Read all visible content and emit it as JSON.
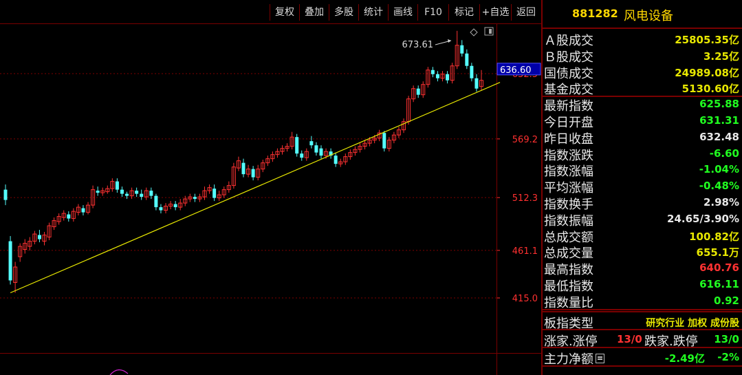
{
  "toolbar": {
    "items": [
      "复权",
      "叠加",
      "多股",
      "统计",
      "画线",
      "F10",
      "标记",
      "+自选",
      "返回"
    ]
  },
  "chart": {
    "price_scale": [
      "632.5",
      "569.2",
      "512.3",
      "461.1",
      "415.0"
    ],
    "current_price_label": "636.60",
    "high_annotation": "673.61",
    "colors": {
      "up": "#ff3232",
      "down": "#54fcfc",
      "trendline": "#e8e800",
      "grid": "#800000"
    }
  },
  "chart_data": {
    "type": "candlestick",
    "price_axis_ticks": [
      632.5,
      569.2,
      512.3,
      461.1,
      415.0
    ],
    "current_price": 636.6,
    "annotated_high": 673.61,
    "candles": [
      {
        "o": 520,
        "c": 510,
        "h": 525,
        "l": 505
      },
      {
        "o": 470,
        "c": 432,
        "h": 475,
        "l": 428
      },
      {
        "o": 430,
        "c": 445,
        "h": 450,
        "l": 420
      },
      {
        "o": 455,
        "c": 465,
        "h": 468,
        "l": 450
      },
      {
        "o": 462,
        "c": 468,
        "h": 472,
        "l": 458
      },
      {
        "o": 465,
        "c": 470,
        "h": 474,
        "l": 461
      },
      {
        "o": 470,
        "c": 477,
        "h": 480,
        "l": 467
      },
      {
        "o": 476,
        "c": 472,
        "h": 481,
        "l": 469
      },
      {
        "o": 470,
        "c": 476,
        "h": 479,
        "l": 466
      },
      {
        "o": 474,
        "c": 485,
        "h": 488,
        "l": 471
      },
      {
        "o": 484,
        "c": 490,
        "h": 493,
        "l": 481
      },
      {
        "o": 489,
        "c": 494,
        "h": 497,
        "l": 486
      },
      {
        "o": 493,
        "c": 497,
        "h": 500,
        "l": 490
      },
      {
        "o": 496,
        "c": 492,
        "h": 499,
        "l": 489
      },
      {
        "o": 492,
        "c": 499,
        "h": 502,
        "l": 489
      },
      {
        "o": 498,
        "c": 503,
        "h": 506,
        "l": 495
      },
      {
        "o": 502,
        "c": 498,
        "h": 505,
        "l": 495
      },
      {
        "o": 498,
        "c": 505,
        "h": 508,
        "l": 496
      },
      {
        "o": 505,
        "c": 520,
        "h": 524,
        "l": 502
      },
      {
        "o": 519,
        "c": 517,
        "h": 523,
        "l": 514
      },
      {
        "o": 517,
        "c": 519,
        "h": 522,
        "l": 514
      },
      {
        "o": 518,
        "c": 521,
        "h": 524,
        "l": 516
      },
      {
        "o": 521,
        "c": 528,
        "h": 531,
        "l": 518
      },
      {
        "o": 528,
        "c": 520,
        "h": 531,
        "l": 517
      },
      {
        "o": 520,
        "c": 516,
        "h": 523,
        "l": 513
      },
      {
        "o": 516,
        "c": 514,
        "h": 518,
        "l": 511
      },
      {
        "o": 514,
        "c": 519,
        "h": 522,
        "l": 511
      },
      {
        "o": 519,
        "c": 516,
        "h": 522,
        "l": 513
      },
      {
        "o": 516,
        "c": 513,
        "h": 520,
        "l": 510
      },
      {
        "o": 513,
        "c": 519,
        "h": 522,
        "l": 510
      },
      {
        "o": 519,
        "c": 514,
        "h": 522,
        "l": 511
      },
      {
        "o": 514,
        "c": 503,
        "h": 516,
        "l": 500
      },
      {
        "o": 503,
        "c": 500,
        "h": 506,
        "l": 497
      },
      {
        "o": 500,
        "c": 504,
        "h": 507,
        "l": 497
      },
      {
        "o": 504,
        "c": 506,
        "h": 509,
        "l": 501
      },
      {
        "o": 506,
        "c": 503,
        "h": 509,
        "l": 500
      },
      {
        "o": 503,
        "c": 507,
        "h": 511,
        "l": 500
      },
      {
        "o": 507,
        "c": 511,
        "h": 514,
        "l": 504
      },
      {
        "o": 511,
        "c": 513,
        "h": 516,
        "l": 508
      },
      {
        "o": 513,
        "c": 511,
        "h": 516,
        "l": 508
      },
      {
        "o": 511,
        "c": 513,
        "h": 516,
        "l": 508
      },
      {
        "o": 513,
        "c": 519,
        "h": 523,
        "l": 510
      },
      {
        "o": 519,
        "c": 522,
        "h": 525,
        "l": 516
      },
      {
        "o": 521,
        "c": 512,
        "h": 525,
        "l": 509
      },
      {
        "o": 512,
        "c": 515,
        "h": 519,
        "l": 509
      },
      {
        "o": 515,
        "c": 520,
        "h": 523,
        "l": 512
      },
      {
        "o": 520,
        "c": 524,
        "h": 528,
        "l": 517
      },
      {
        "o": 524,
        "c": 542,
        "h": 546,
        "l": 521
      },
      {
        "o": 541,
        "c": 548,
        "h": 552,
        "l": 538
      },
      {
        "o": 546,
        "c": 535,
        "h": 550,
        "l": 532
      },
      {
        "o": 535,
        "c": 540,
        "h": 544,
        "l": 532
      },
      {
        "o": 540,
        "c": 532,
        "h": 543,
        "l": 529
      },
      {
        "o": 532,
        "c": 540,
        "h": 544,
        "l": 529
      },
      {
        "o": 540,
        "c": 546,
        "h": 549,
        "l": 537
      },
      {
        "o": 546,
        "c": 550,
        "h": 553,
        "l": 543
      },
      {
        "o": 550,
        "c": 554,
        "h": 557,
        "l": 547
      },
      {
        "o": 554,
        "c": 557,
        "h": 560,
        "l": 551
      },
      {
        "o": 557,
        "c": 560,
        "h": 563,
        "l": 554
      },
      {
        "o": 560,
        "c": 562,
        "h": 565,
        "l": 557
      },
      {
        "o": 562,
        "c": 571,
        "h": 576,
        "l": 559
      },
      {
        "o": 571,
        "c": 555,
        "h": 574,
        "l": 552
      },
      {
        "o": 555,
        "c": 551,
        "h": 558,
        "l": 548
      },
      {
        "o": 551,
        "c": 557,
        "h": 560,
        "l": 548
      },
      {
        "o": 567,
        "c": 563,
        "h": 572,
        "l": 560
      },
      {
        "o": 563,
        "c": 556,
        "h": 566,
        "l": 553
      },
      {
        "o": 560,
        "c": 553,
        "h": 563,
        "l": 550
      },
      {
        "o": 553,
        "c": 557,
        "h": 560,
        "l": 550
      },
      {
        "o": 557,
        "c": 553,
        "h": 560,
        "l": 550
      },
      {
        "o": 553,
        "c": 545,
        "h": 556,
        "l": 542
      },
      {
        "o": 545,
        "c": 547,
        "h": 550,
        "l": 542
      },
      {
        "o": 547,
        "c": 552,
        "h": 555,
        "l": 544
      },
      {
        "o": 552,
        "c": 556,
        "h": 559,
        "l": 549
      },
      {
        "o": 556,
        "c": 559,
        "h": 562,
        "l": 553
      },
      {
        "o": 559,
        "c": 562,
        "h": 565,
        "l": 556
      },
      {
        "o": 562,
        "c": 565,
        "h": 568,
        "l": 559
      },
      {
        "o": 565,
        "c": 568,
        "h": 571,
        "l": 562
      },
      {
        "o": 568,
        "c": 570,
        "h": 573,
        "l": 565
      },
      {
        "o": 570,
        "c": 575,
        "h": 578,
        "l": 567
      },
      {
        "o": 575,
        "c": 560,
        "h": 577,
        "l": 557
      },
      {
        "o": 560,
        "c": 568,
        "h": 571,
        "l": 557
      },
      {
        "o": 568,
        "c": 573,
        "h": 576,
        "l": 565
      },
      {
        "o": 573,
        "c": 578,
        "h": 581,
        "l": 570
      },
      {
        "o": 578,
        "c": 586,
        "h": 589,
        "l": 575
      },
      {
        "o": 586,
        "c": 608,
        "h": 611,
        "l": 583
      },
      {
        "o": 608,
        "c": 618,
        "h": 621,
        "l": 605
      },
      {
        "o": 618,
        "c": 612,
        "h": 621,
        "l": 609
      },
      {
        "o": 612,
        "c": 622,
        "h": 625,
        "l": 609
      },
      {
        "o": 622,
        "c": 636,
        "h": 639,
        "l": 619
      },
      {
        "o": 636,
        "c": 632,
        "h": 639,
        "l": 629
      },
      {
        "o": 632,
        "c": 628,
        "h": 635,
        "l": 625
      },
      {
        "o": 628,
        "c": 632,
        "h": 635,
        "l": 625
      },
      {
        "o": 632,
        "c": 626,
        "h": 635,
        "l": 623
      },
      {
        "o": 626,
        "c": 640,
        "h": 643,
        "l": 623
      },
      {
        "o": 640,
        "c": 660,
        "h": 674,
        "l": 637
      },
      {
        "o": 660,
        "c": 652,
        "h": 665,
        "l": 649
      },
      {
        "o": 652,
        "c": 640,
        "h": 656,
        "l": 637
      },
      {
        "o": 640,
        "c": 628,
        "h": 643,
        "l": 625
      },
      {
        "o": 628,
        "c": 618,
        "h": 632,
        "l": 615
      },
      {
        "o": 620,
        "c": 626,
        "h": 636,
        "l": 616
      }
    ],
    "trendline": [
      {
        "i": 1,
        "p": 420
      },
      {
        "i": 99,
        "p": 622
      }
    ]
  },
  "panel": {
    "code": "881282",
    "name": "风电设备",
    "rows": [
      {
        "label": "Ａ股成交",
        "value": "25805.35亿",
        "color": "#e8e800"
      },
      {
        "label": "Ｂ股成交",
        "value": "3.25亿",
        "color": "#e8e800"
      },
      {
        "label": "国债成交",
        "value": "24989.08亿",
        "color": "#e8e800"
      },
      {
        "label": "基金成交",
        "value": "5130.60亿",
        "color": "#e8e800"
      },
      {
        "label": "最新指数",
        "value": "625.88",
        "color": "#20ff20"
      },
      {
        "label": "今日开盘",
        "value": "631.31",
        "color": "#20ff20"
      },
      {
        "label": "昨日收盘",
        "value": "632.48",
        "color": "#e8e8e8"
      },
      {
        "label": "指数涨跌",
        "value": "-6.60",
        "color": "#20ff20"
      },
      {
        "label": "指数涨幅",
        "value": "-1.04%",
        "color": "#20ff20"
      },
      {
        "label": "平均涨幅",
        "value": "-0.48%",
        "color": "#20ff20"
      },
      {
        "label": "指数换手",
        "value": "2.98%",
        "color": "#e8e8e8"
      },
      {
        "label": "指数振幅",
        "value": "24.65/3.90%",
        "color": "#e8e8e8"
      },
      {
        "label": "总成交额",
        "value": "100.82亿",
        "color": "#e8e800"
      },
      {
        "label": "总成交量",
        "value": "655.1万",
        "color": "#e8e800"
      },
      {
        "label": "最高指数",
        "value": "640.76",
        "color": "#ff3232"
      },
      {
        "label": "最低指数",
        "value": "616.11",
        "color": "#20ff20"
      },
      {
        "label": "指数量比",
        "value": "0.92",
        "color": "#20ff20"
      }
    ],
    "index_type": {
      "label": "板指类型",
      "value": "研究行业 加权 成份股"
    },
    "updown": {
      "label1": "涨家.涨停",
      "value1": "13/0",
      "label2": "跌家.跌停",
      "value2": "13/0"
    },
    "net_flow": {
      "label": "主力净额",
      "value": "-2.49亿",
      "pct": "-2%"
    }
  }
}
